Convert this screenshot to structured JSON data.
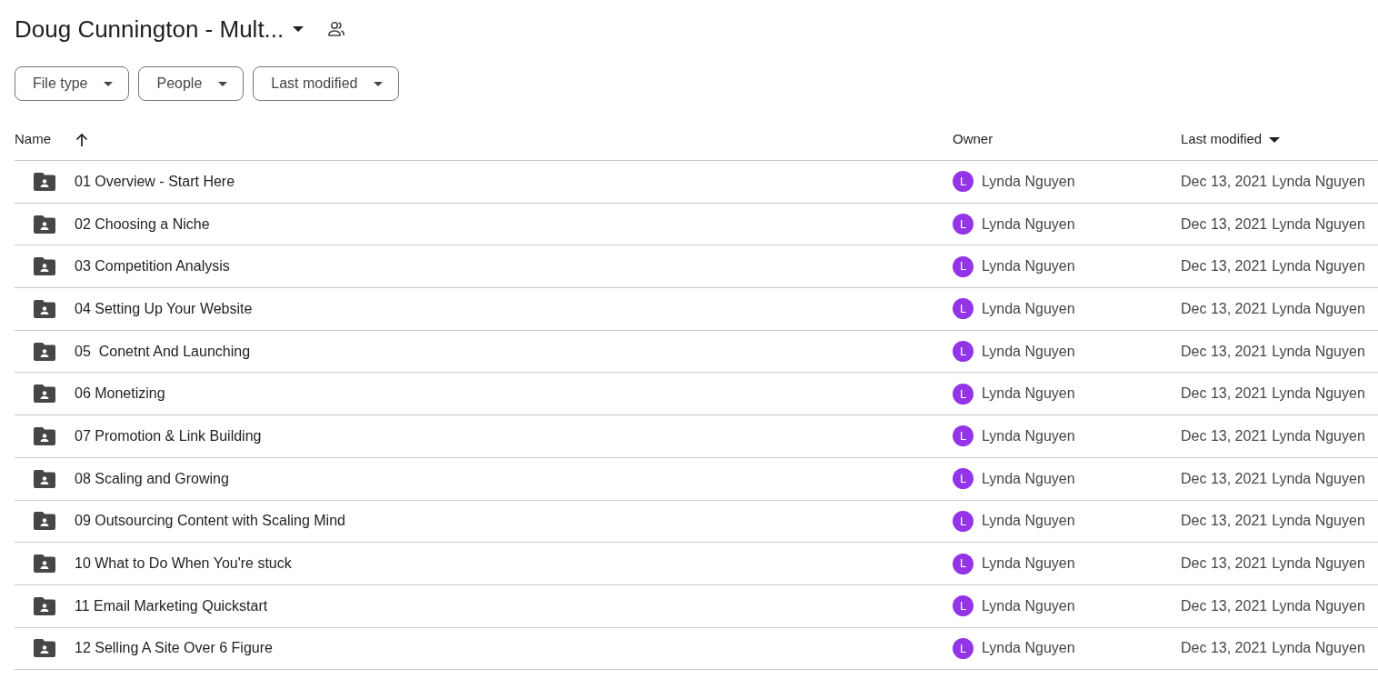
{
  "folder": {
    "title": "Doug Cunnington - Mult..."
  },
  "filters": [
    {
      "label": "File type"
    },
    {
      "label": "People"
    },
    {
      "label": "Last modified"
    }
  ],
  "table": {
    "columns": [
      {
        "label": "Name",
        "kind": "ascending"
      },
      {
        "label": "Owner",
        "kind": "plain"
      },
      {
        "label": "Last modified",
        "kind": "descending"
      }
    ],
    "rows": [
      {
        "name": "01 Overview - Start Here",
        "owner": "Lynda Nguyen",
        "owner_initial": "L",
        "color": "#9334e6",
        "date": "Dec 13, 2021",
        "modified_by": "Lynda Nguyen"
      },
      {
        "name": "02 Choosing a Niche",
        "owner": "Lynda Nguyen",
        "owner_initial": "L",
        "color": "#9334e6",
        "date": "Dec 13, 2021",
        "modified_by": "Lynda Nguyen"
      },
      {
        "name": "03 Competition Analysis",
        "owner": "Lynda Nguyen",
        "owner_initial": "L",
        "color": "#9334e6",
        "date": "Dec 13, 2021",
        "modified_by": "Lynda Nguyen"
      },
      {
        "name": "04 Setting Up Your Website",
        "owner": "Lynda Nguyen",
        "owner_initial": "L",
        "color": "#9334e6",
        "date": "Dec 13, 2021",
        "modified_by": "Lynda Nguyen"
      },
      {
        "name": "05  Conetnt And Launching",
        "owner": "Lynda Nguyen",
        "owner_initial": "L",
        "color": "#9334e6",
        "date": "Dec 13, 2021",
        "modified_by": "Lynda Nguyen"
      },
      {
        "name": "06 Monetizing",
        "owner": "Lynda Nguyen",
        "owner_initial": "L",
        "color": "#9334e6",
        "date": "Dec 13, 2021",
        "modified_by": "Lynda Nguyen"
      },
      {
        "name": "07 Promotion & Link Building",
        "owner": "Lynda Nguyen",
        "owner_initial": "L",
        "color": "#9334e6",
        "date": "Dec 13, 2021",
        "modified_by": "Lynda Nguyen"
      },
      {
        "name": "08 Scaling and Growing",
        "owner": "Lynda Nguyen",
        "owner_initial": "L",
        "color": "#9334e6",
        "date": "Dec 13, 2021",
        "modified_by": "Lynda Nguyen"
      },
      {
        "name": "09 Outsourcing Content with Scaling Mind",
        "owner": "Lynda Nguyen",
        "owner_initial": "L",
        "color": "#9334e6",
        "date": "Dec 13, 2021",
        "modified_by": "Lynda Nguyen"
      },
      {
        "name": "10 What to Do When You're stuck",
        "owner": "Lynda Nguyen",
        "owner_initial": "L",
        "color": "#9334e6",
        "date": "Dec 13, 2021",
        "modified_by": "Lynda Nguyen"
      },
      {
        "name": "11 Email Marketing Quickstart",
        "owner": "Lynda Nguyen",
        "owner_initial": "L",
        "color": "#9334e6",
        "date": "Dec 13, 2021",
        "modified_by": "Lynda Nguyen"
      },
      {
        "name": "12 Selling A Site Over 6 Figure",
        "owner": "Lynda Nguyen",
        "owner_initial": "L",
        "color": "#9334e6",
        "date": "Dec 13, 2021",
        "modified_by": "Lynda Nguyen"
      }
    ]
  }
}
